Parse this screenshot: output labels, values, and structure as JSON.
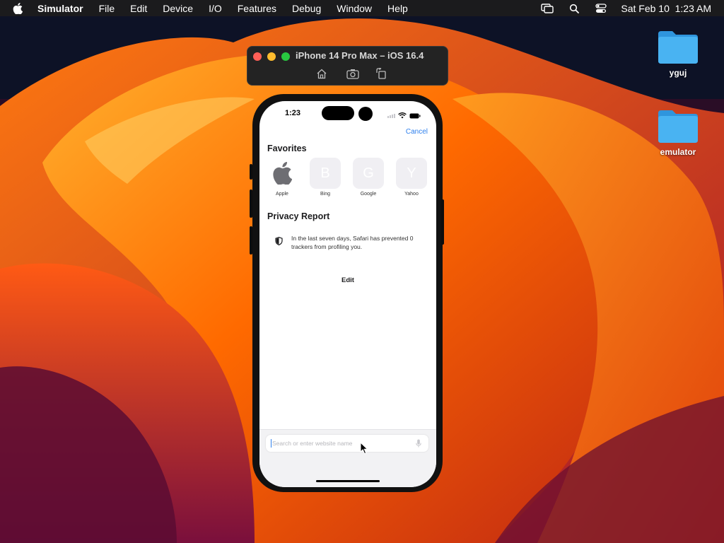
{
  "menubar": {
    "items": [
      "Simulator",
      "File",
      "Edit",
      "Device",
      "I/O",
      "Features",
      "Debug",
      "Window",
      "Help"
    ],
    "clock": "Sat Feb 10  1:23 AM",
    "status_icons": [
      "screen-mirror-icon",
      "search-icon",
      "control-center-icon"
    ]
  },
  "desktop": {
    "icons": [
      {
        "label": "yguj",
        "icon": "folder-icon"
      },
      {
        "label": "emulator",
        "icon": "folder-icon"
      }
    ]
  },
  "simulator": {
    "title": "iPhone 14 Pro Max – iOS 16.4",
    "buttons": [
      "home-icon",
      "screenshot-icon",
      "rotate-icon"
    ]
  },
  "phone": {
    "status_time": "1:23",
    "cancel_label": "Cancel",
    "favorites_title": "Favorites",
    "favorites": [
      {
        "label": "Apple",
        "glyph": ""
      },
      {
        "label": "Bing",
        "glyph": "B"
      },
      {
        "label": "Google",
        "glyph": "G"
      },
      {
        "label": "Yahoo",
        "glyph": "Y"
      }
    ],
    "privacy_title": "Privacy Report",
    "privacy_text": "In the last seven days, Safari has prevented 0 trackers from profiling you.",
    "edit_label": "Edit",
    "search_placeholder": "Search or enter website name"
  },
  "colors": {
    "accent": "#2f80ed",
    "traffic_red": "#ff5f57",
    "traffic_yellow": "#febc2e",
    "traffic_green": "#28c840",
    "folder": "#3aa7f0"
  }
}
